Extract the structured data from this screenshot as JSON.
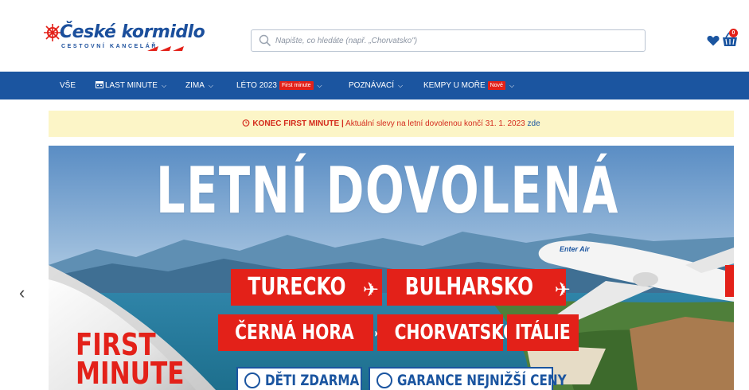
{
  "brand": {
    "name": "České kormidlo",
    "subtitle": "CESTOVNÍ KANCELÁŘ"
  },
  "search": {
    "placeholder": "Napište, co hledáte (např. „Chorvatsko\")"
  },
  "cart": {
    "count": "0"
  },
  "nav": {
    "items": [
      {
        "label": "VŠE"
      },
      {
        "label": "LAST MINUTE"
      },
      {
        "label": "ZIMA"
      },
      {
        "label": "LÉTO 2023",
        "tag": "First minute"
      },
      {
        "label": "POZNÁVACÍ"
      },
      {
        "label": "KEMPY U MOŘE",
        "tag": "Nové"
      }
    ]
  },
  "notice": {
    "strong": "KONEC FIRST MINUTE |",
    "text": "Aktuální slevy na letní dovolenou končí 31. 1. 2023",
    "link": "zde"
  },
  "banner": {
    "title": "LETNÍ DOVOLENÁ",
    "destinations": [
      "TURECKO",
      "BULHARSKO",
      "ČERNÁ HORA",
      "CHORVATSKO",
      "ITÁLIE"
    ],
    "badges": [
      "DĚTI ZDARMA",
      "GARANCE NEJNIŽŠÍ CENY"
    ],
    "corner_text": [
      "FIRST",
      "MINUTE"
    ],
    "plane_logo": "Enter Air"
  },
  "colors": {
    "brand_blue": "#1b55a0",
    "accent_red": "#e32119",
    "notice_bg": "#fcf5c7"
  }
}
